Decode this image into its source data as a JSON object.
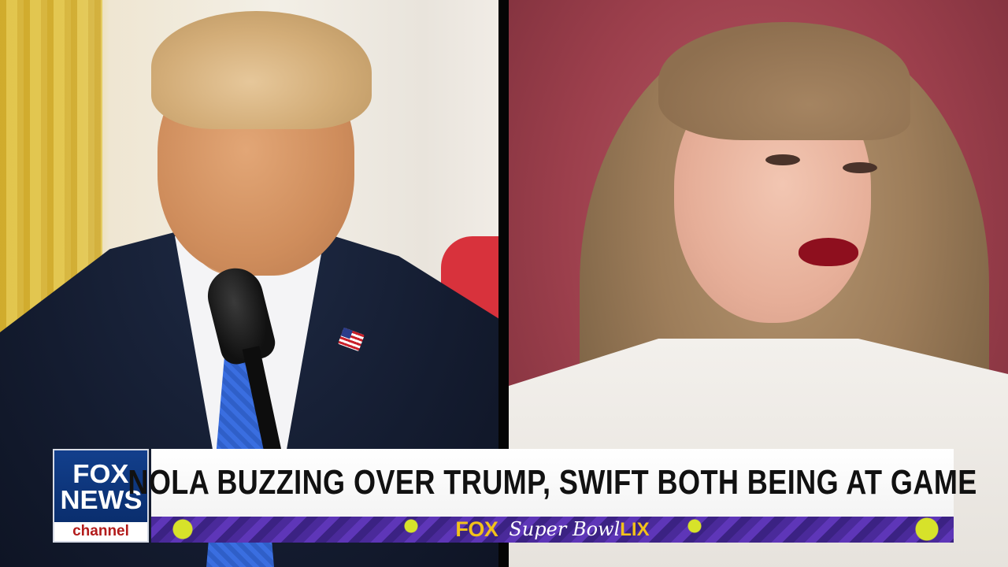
{
  "network": {
    "logo_lines": [
      "FOX",
      "NEWS"
    ],
    "logo_channel": "channel"
  },
  "chyron": {
    "headline": "NOLA BUZZING OVER TRUMP, SWIFT BOTH BEING AT GAME"
  },
  "ticker": {
    "brand": "FOX",
    "event_script": "Super Bowl",
    "event_numeral": "LIX"
  },
  "colors": {
    "logo_blue": "#0a2e6e",
    "channel_red": "#b21b1b",
    "ticker_purple": "#4a2a9a",
    "ticker_gold": "#f2c21a",
    "accent_lime": "#d7e22a"
  }
}
